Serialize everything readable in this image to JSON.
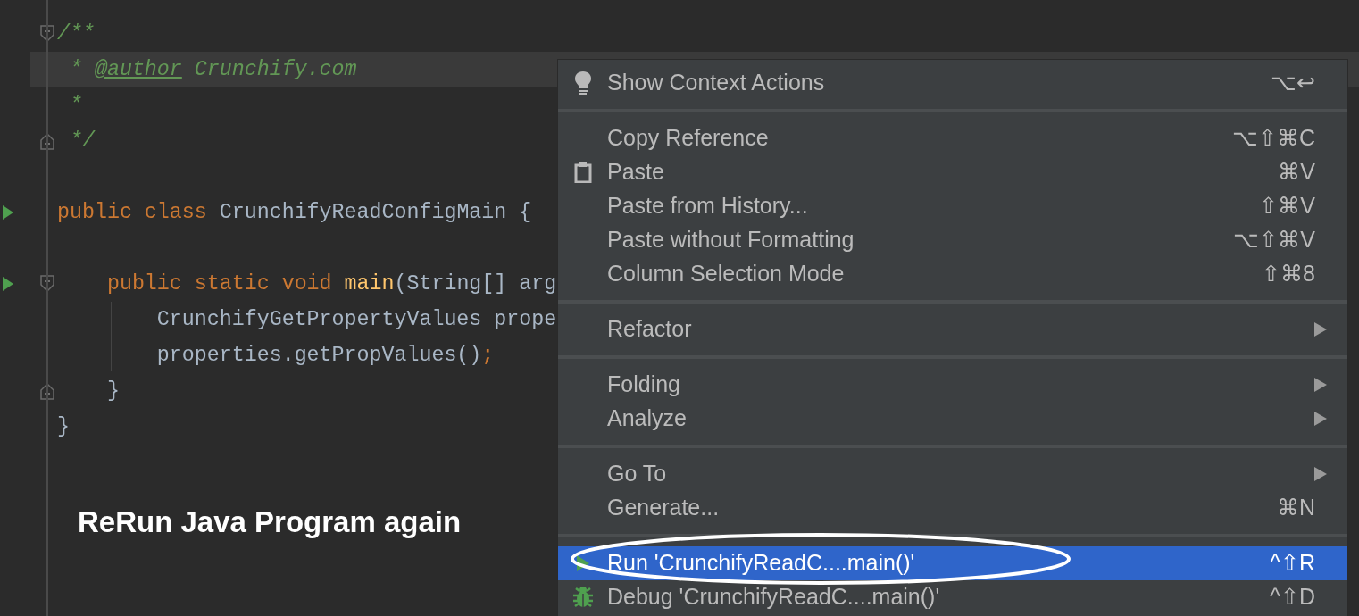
{
  "editor": {
    "lines": [
      {
        "tokens": [
          {
            "text": "/**",
            "kind": "comment"
          }
        ],
        "run": false,
        "kind": "fold-start",
        "current": false
      },
      {
        "tokens": [
          {
            "text": " * ",
            "kind": "comment"
          },
          {
            "text": "@author",
            "kind": "doctag"
          },
          {
            "text": " Crunchify.com",
            "kind": "comment"
          }
        ],
        "run": false,
        "kind": "plain",
        "current": true
      },
      {
        "tokens": [
          {
            "text": " *",
            "kind": "comment"
          }
        ],
        "run": false,
        "kind": "plain",
        "current": false
      },
      {
        "tokens": [
          {
            "text": " */",
            "kind": "comment"
          }
        ],
        "run": false,
        "kind": "fold-end",
        "current": false
      },
      {
        "run": false,
        "kind": "plain",
        "current": false
      },
      {
        "tokens": [
          {
            "text": "public class ",
            "kind": "keyword"
          },
          {
            "text": "CrunchifyReadConfigMain {",
            "kind": "plain"
          }
        ],
        "run": true,
        "kind": "plain",
        "current": false
      },
      {
        "run": false,
        "kind": "plain",
        "current": false
      },
      {
        "tokens": [
          {
            "text": "    public static void ",
            "kind": "keyword"
          },
          {
            "text": "main",
            "kind": "method"
          },
          {
            "text": "(String[] arg",
            "kind": "plain"
          }
        ],
        "run": true,
        "kind": "fold-start",
        "current": false
      },
      {
        "tokens": [
          {
            "text": "        CrunchifyGetPropertyValues prope",
            "kind": "plain"
          }
        ],
        "run": false,
        "kind": "plain",
        "current": false
      },
      {
        "tokens": [
          {
            "text": "        properties.getPropValues()",
            "kind": "plain"
          },
          {
            "text": ";",
            "kind": "keyword"
          }
        ],
        "run": false,
        "kind": "plain",
        "current": false
      },
      {
        "tokens": [
          {
            "text": "    }",
            "kind": "plain"
          }
        ],
        "run": false,
        "kind": "fold-end",
        "current": false
      },
      {
        "tokens": [
          {
            "text": "}",
            "kind": "plain"
          }
        ],
        "run": false,
        "kind": "plain",
        "current": false
      }
    ]
  },
  "annotation": {
    "caption": "ReRun Java Program again"
  },
  "context_menu": {
    "groups": [
      [
        {
          "label": "Show Context Actions",
          "shortcut": "⌥↩",
          "kind": "bulb",
          "submenu": false,
          "selected": false
        }
      ],
      [
        {
          "label": "Copy Reference",
          "shortcut": "⌥⇧⌘C",
          "kind": "plain",
          "submenu": false,
          "selected": false
        },
        {
          "label": "Paste",
          "shortcut": "⌘V",
          "kind": "clipboard",
          "submenu": false,
          "selected": false
        },
        {
          "label": "Paste from History...",
          "shortcut": "⇧⌘V",
          "kind": "plain",
          "submenu": false,
          "selected": false
        },
        {
          "label": "Paste without Formatting",
          "shortcut": "⌥⇧⌘V",
          "kind": "plain",
          "submenu": false,
          "selected": false
        },
        {
          "label": "Column Selection Mode",
          "shortcut": "⇧⌘8",
          "kind": "plain",
          "submenu": false,
          "selected": false
        }
      ],
      [
        {
          "label": "Refactor",
          "kind": "plain",
          "submenu": true,
          "selected": false
        }
      ],
      [
        {
          "label": "Folding",
          "kind": "plain",
          "submenu": true,
          "selected": false
        },
        {
          "label": "Analyze",
          "kind": "plain",
          "submenu": true,
          "selected": false
        }
      ],
      [
        {
          "label": "Go To",
          "kind": "plain",
          "submenu": true,
          "selected": false
        },
        {
          "label": "Generate...",
          "shortcut": "⌘N",
          "kind": "plain",
          "submenu": false,
          "selected": false
        }
      ],
      [
        {
          "label": "Run 'CrunchifyReadC....main()'",
          "shortcut": "^⇧R",
          "kind": "run",
          "submenu": false,
          "selected": true
        },
        {
          "label": "Debug 'CrunchifyReadC....main()'",
          "shortcut": "^⇧D",
          "kind": "debug",
          "submenu": false,
          "selected": false
        }
      ]
    ]
  }
}
